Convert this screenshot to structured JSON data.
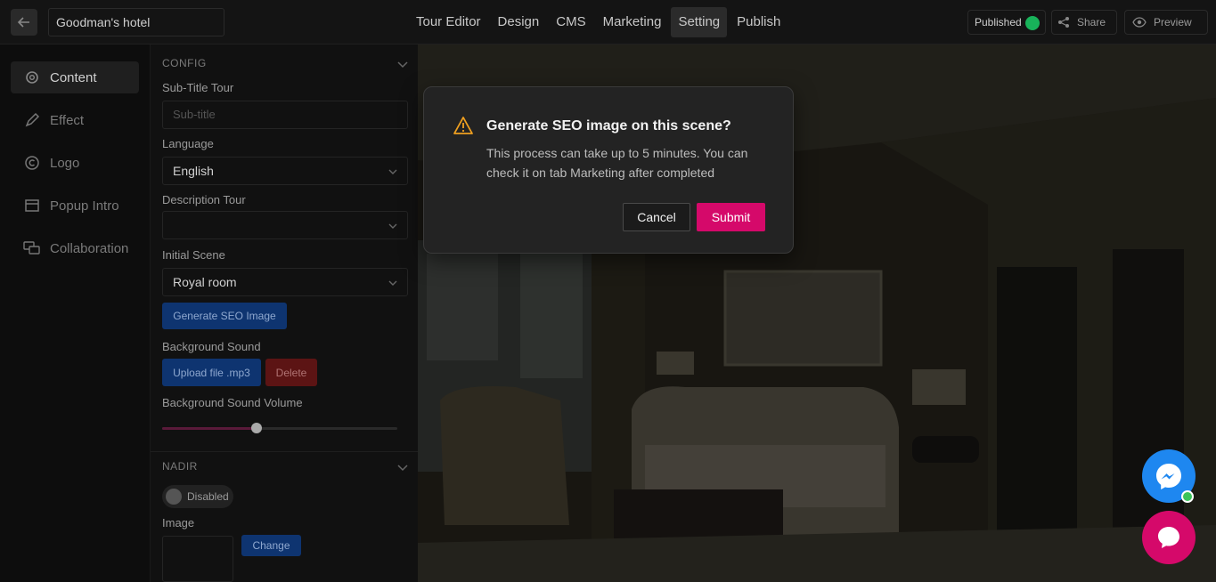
{
  "header": {
    "tour_name": "Goodman's hotel",
    "nav": [
      "Tour Editor",
      "Design",
      "CMS",
      "Marketing",
      "Setting",
      "Publish"
    ],
    "active_nav": "Setting",
    "status": "Published",
    "share_label": "Share",
    "preview_label": "Preview"
  },
  "sidebar": {
    "items": [
      {
        "label": "Content",
        "icon": "gear-icon"
      },
      {
        "label": "Effect",
        "icon": "pencil-icon"
      },
      {
        "label": "Logo",
        "icon": "copyright-icon"
      },
      {
        "label": "Popup Intro",
        "icon": "window-icon"
      },
      {
        "label": "Collaboration",
        "icon": "chat-bubbles-icon"
      }
    ]
  },
  "config": {
    "section_title": "CONFIG",
    "subtitle_label": "Sub-Title Tour",
    "subtitle_placeholder": "Sub-title",
    "language_label": "Language",
    "language_value": "English",
    "description_label": "Description Tour",
    "initial_scene_label": "Initial Scene",
    "initial_scene_value": "Royal room",
    "generate_seo_label": "Generate SEO Image",
    "bg_sound_label": "Background Sound",
    "upload_label": "Upload file .mp3",
    "delete_label": "Delete",
    "bg_volume_label": "Background Sound Volume",
    "bg_volume_fraction": 0.4
  },
  "nadir": {
    "section_title": "NADIR",
    "toggle_label": "Disabled",
    "image_label": "Image",
    "change_label": "Change"
  },
  "modal": {
    "title": "Generate SEO image on this scene?",
    "body": "This process can take up to 5 minutes. You can check it on tab Marketing after completed",
    "cancel_label": "Cancel",
    "submit_label": "Submit"
  },
  "colors": {
    "accent": "#d5096a",
    "messenger": "#1e87f0",
    "published": "#18b35a"
  }
}
